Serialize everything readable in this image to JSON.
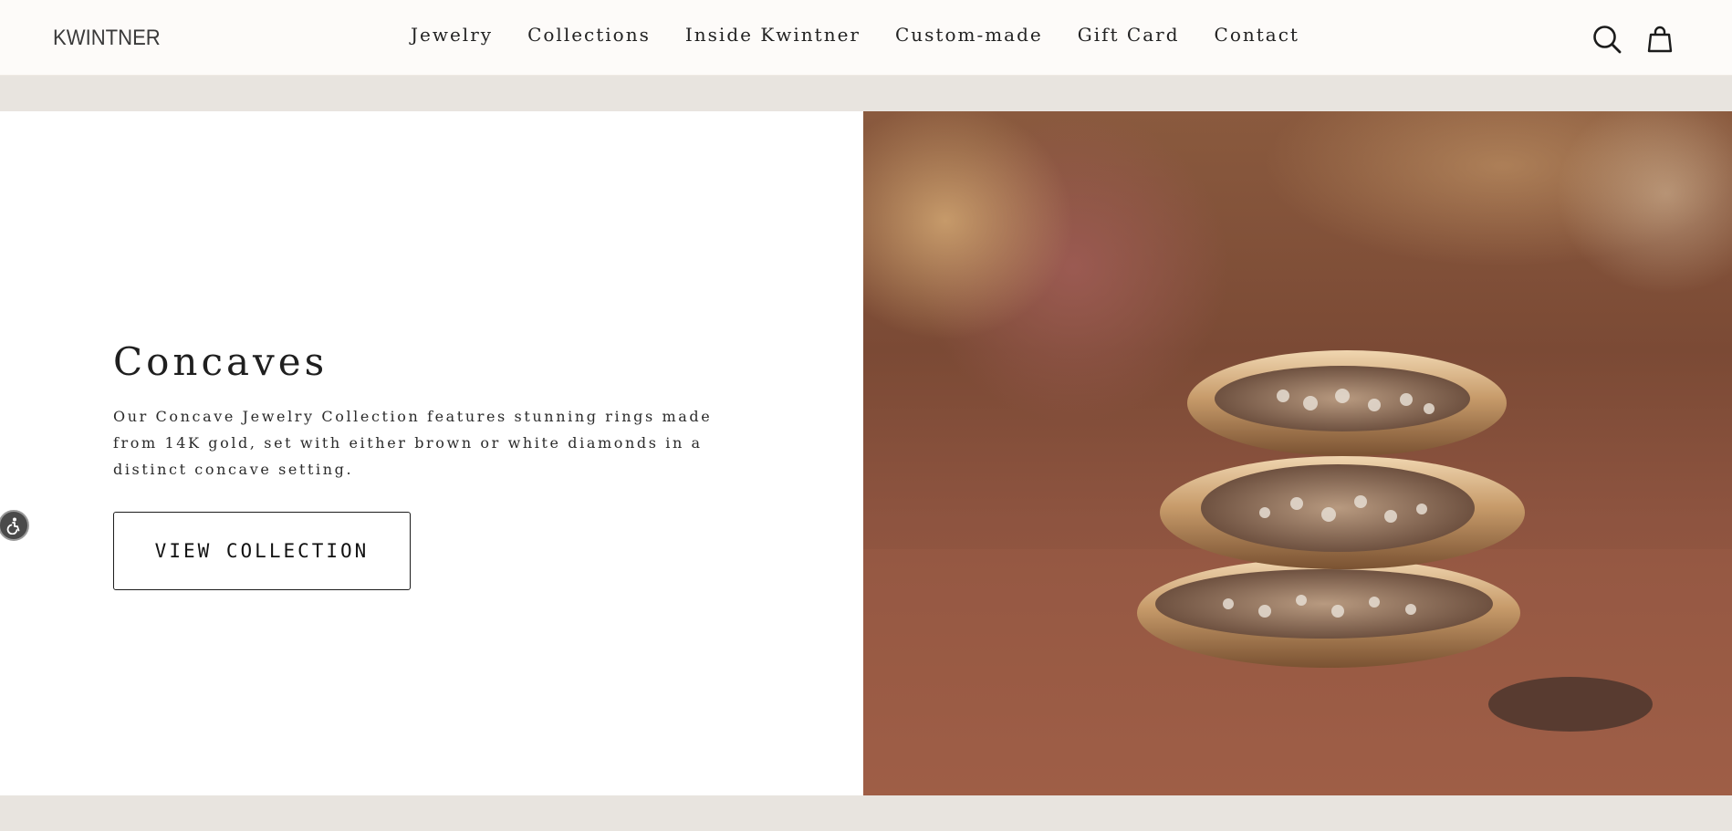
{
  "header": {
    "logo": "KWINTNER",
    "nav": [
      {
        "label": "Jewelry"
      },
      {
        "label": "Collections"
      },
      {
        "label": "Inside Kwintner"
      },
      {
        "label": "Custom-made"
      },
      {
        "label": "Gift Card"
      },
      {
        "label": "Contact"
      }
    ],
    "icons": {
      "search": "search-icon",
      "cart": "shopping-bag-icon"
    }
  },
  "feature": {
    "title": "Concaves",
    "description": "Our Concave Jewelry Collection features stunning rings made from 14K gold, set with either brown or white diamonds in a distinct concave setting.",
    "button_label": "VIEW COLLECTION",
    "image_subject": "stacked concave gold rings with diamonds"
  },
  "accessibility": {
    "icon": "accessibility-icon"
  },
  "colors": {
    "header_bg": "#fdfbf9",
    "band_bg": "#e8e4df",
    "text": "#1f1f1f"
  }
}
